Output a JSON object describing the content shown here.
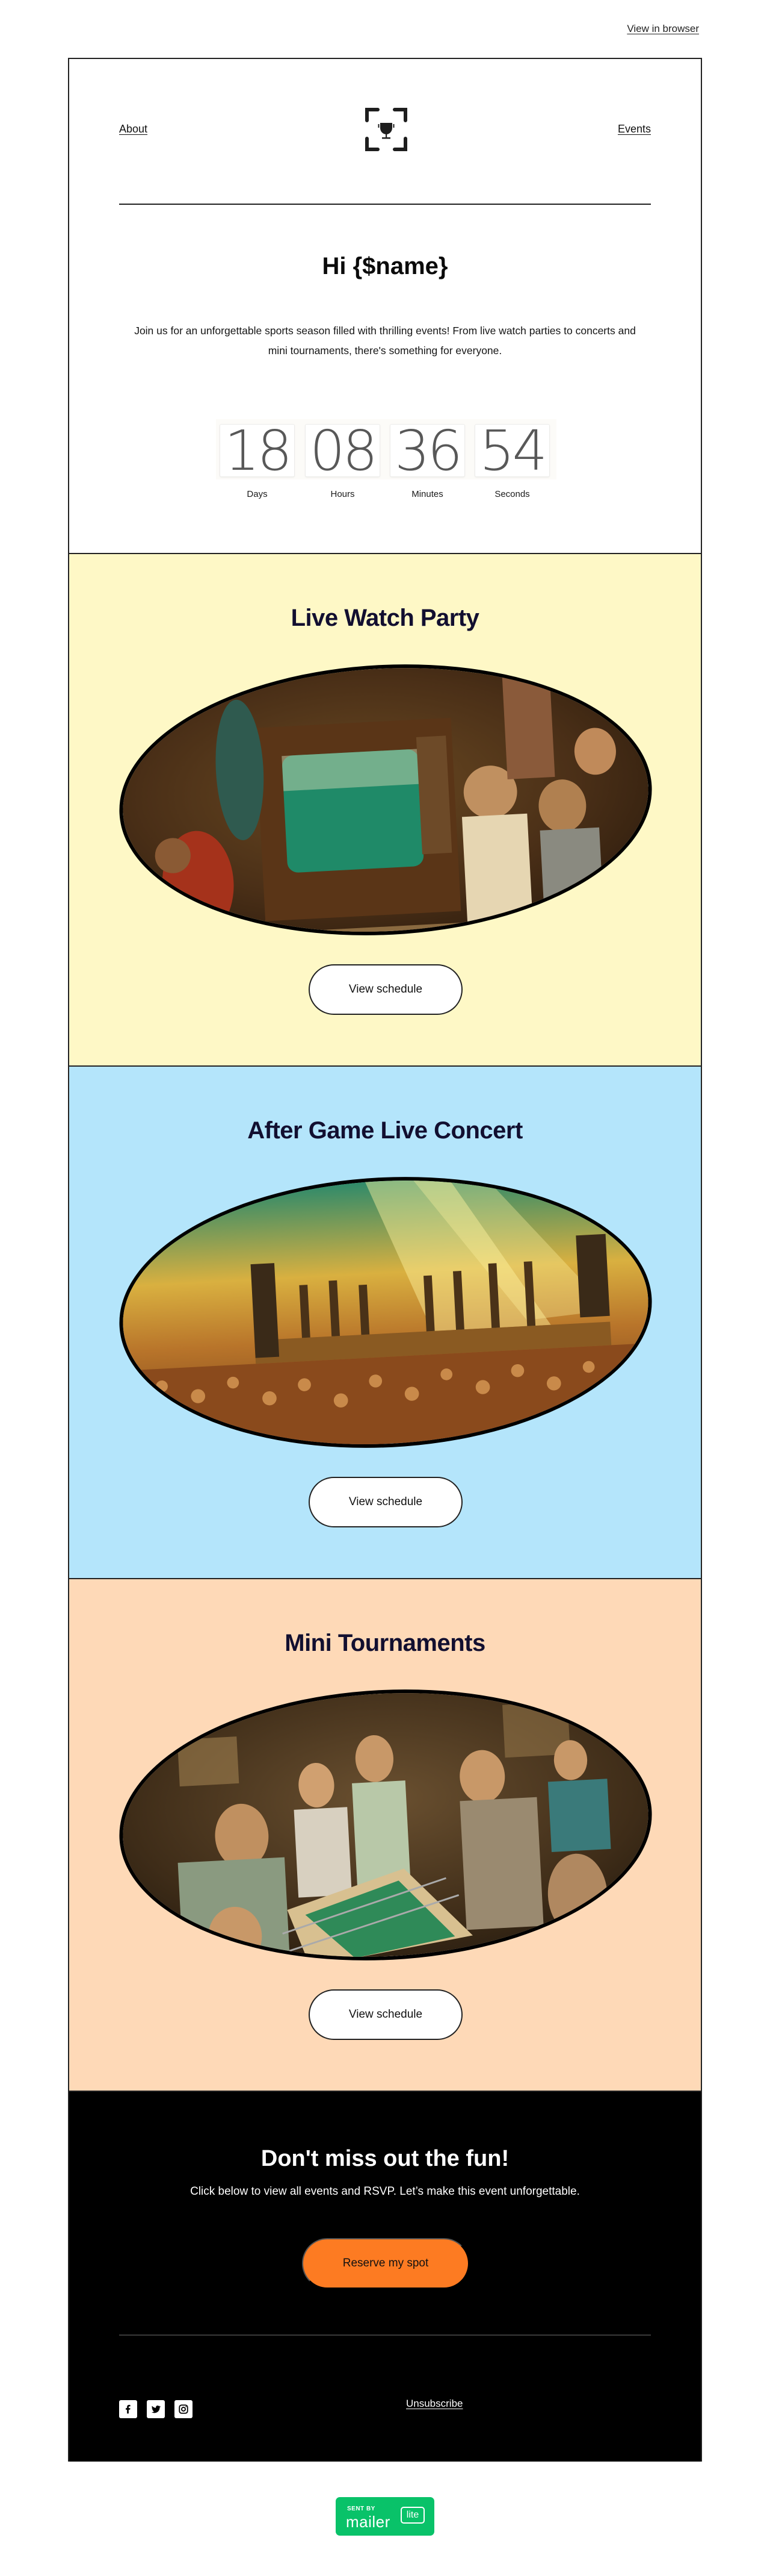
{
  "topbar": {
    "view_in_browser": "View in browser"
  },
  "header": {
    "nav_left": "About",
    "nav_right": "Events",
    "logo_icon": "trophy-frame-icon",
    "greeting": "Hi {$name}",
    "intro": "Join us for an unforgettable sports season filled with thrilling events! From live watch parties to concerts and mini tournaments, there's something for everyone."
  },
  "countdown": {
    "units": [
      {
        "value": "18",
        "label": "Days"
      },
      {
        "value": "08",
        "label": "Hours"
      },
      {
        "value": "36",
        "label": "Minutes"
      },
      {
        "value": "54",
        "label": "Seconds"
      }
    ]
  },
  "events": [
    {
      "title": "Live Watch Party",
      "image": "vintage-tv-watch-party-image",
      "button": "View schedule",
      "bg": "#fef8c6"
    },
    {
      "title": "After Game Live Concert",
      "image": "stage-concert-crowd-image",
      "button": "View schedule",
      "bg": "#b4e5fb"
    },
    {
      "title": "Mini Tournaments",
      "image": "foosball-tournament-image",
      "button": "View schedule",
      "bg": "#fed9b7"
    }
  ],
  "cta": {
    "title": "Don't miss out the fun!",
    "text": "Click below to view all events and RSVP. Let’s make this event unforgettable.",
    "button": "Reserve my spot",
    "button_color": "#fd7b22"
  },
  "footer": {
    "socials": [
      "facebook-icon",
      "twitter-icon",
      "instagram-icon"
    ],
    "unsubscribe": "Unsubscribe"
  },
  "badge": {
    "sent_by": "SENT BY",
    "mailer": "mailer",
    "lite": "lite",
    "color": "#09c269"
  }
}
